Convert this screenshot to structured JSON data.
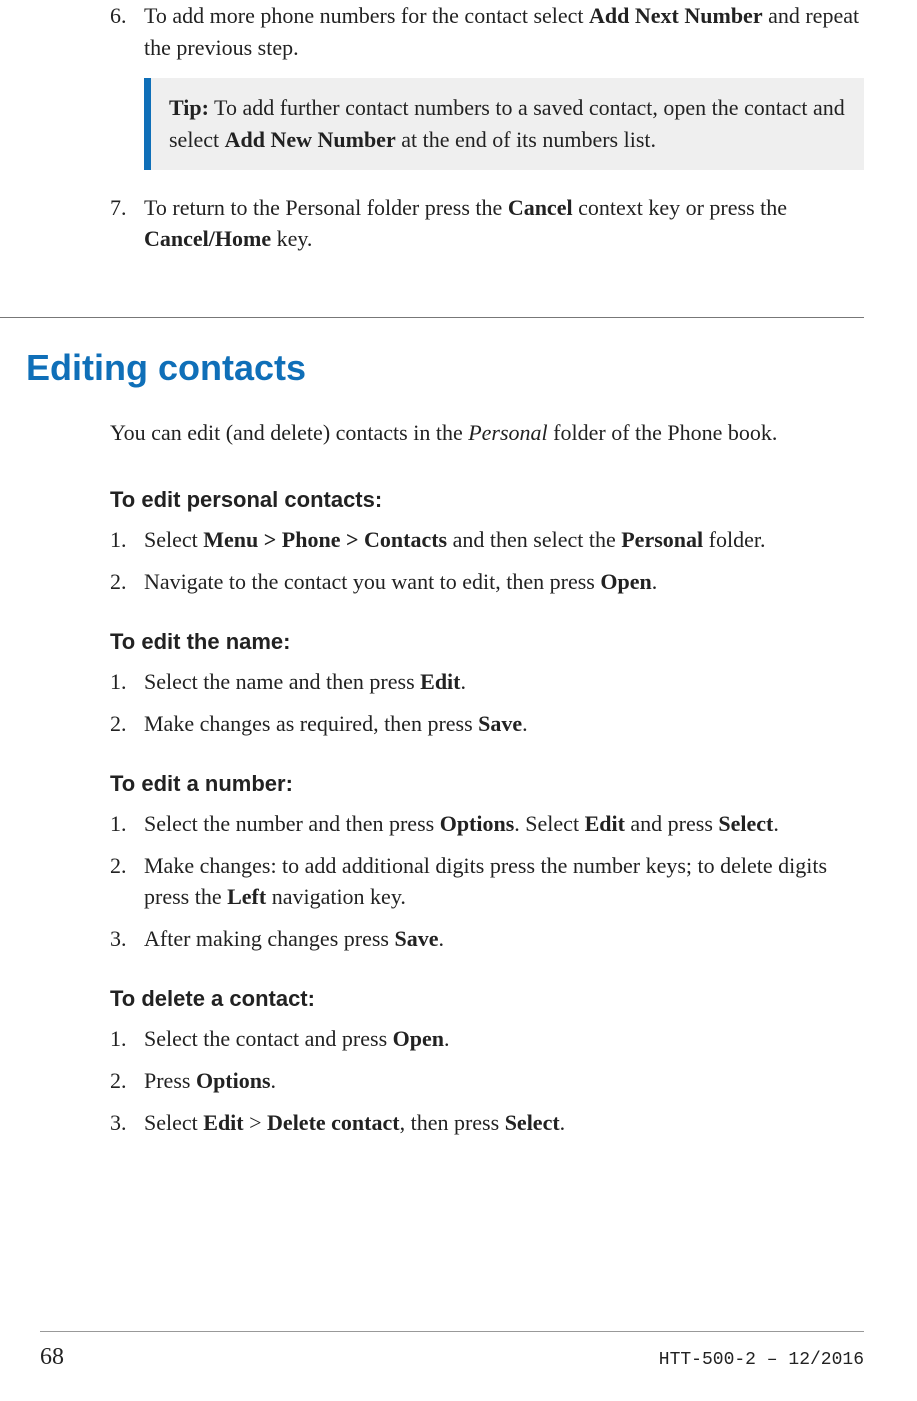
{
  "steps_cont": {
    "item6": {
      "num": "6.",
      "pre": "To add more phone numbers for the contact select ",
      "bold": "Add Next Number",
      "post": " and repeat the previous step."
    },
    "tip": {
      "label": "Tip:",
      "pre": "  To add further contact numbers to a saved contact, open the contact and select ",
      "bold": "Add New Number",
      "post": " at the end of its numbers list."
    },
    "item7": {
      "num": "7.",
      "pre": "To return to the Personal folder press the ",
      "bold1": "Cancel",
      "mid": " context key or press the ",
      "bold2": "Cancel/Home",
      "post": " key."
    }
  },
  "section": {
    "title": "Editing contacts",
    "intro_pre": "You can edit (and delete) contacts in the ",
    "intro_italic": "Personal",
    "intro_post": " folder of the Phone book."
  },
  "edit_personal": {
    "head": "To edit personal contacts:",
    "s1": {
      "num": "1.",
      "pre": "Select ",
      "bold1": "Menu > Phone > Contacts",
      "mid": " and then select the ",
      "bold2": "Personal",
      "post": " folder."
    },
    "s2": {
      "num": "2.",
      "pre": "Navigate to the contact you want to edit, then press ",
      "bold": "Open",
      "post": "."
    }
  },
  "edit_name": {
    "head": "To edit the name:",
    "s1": {
      "num": "1.",
      "pre": "Select the name and then press ",
      "bold": "Edit",
      "post": "."
    },
    "s2": {
      "num": "2.",
      "pre": "Make changes as required, then press ",
      "bold": "Save",
      "post": "."
    }
  },
  "edit_number": {
    "head": "To edit a number:",
    "s1": {
      "num": "1.",
      "pre": "Select the number and then press ",
      "bold1": "Options",
      "mid": ". Select ",
      "bold2": "Edit",
      "mid2": " and press ",
      "bold3": "Select",
      "post": "."
    },
    "s2": {
      "num": "2.",
      "pre": "Make changes: to add additional digits press the number keys; to delete digits press the ",
      "bold": "Left",
      "post": " navigation key."
    },
    "s3": {
      "num": "3.",
      "pre": "After making changes press ",
      "bold": "Save",
      "post": "."
    }
  },
  "delete_contact": {
    "head": "To delete a contact:",
    "s1": {
      "num": "1.",
      "pre": "Select the contact and press ",
      "bold": "Open",
      "post": "."
    },
    "s2": {
      "num": "2.",
      "pre": "Press ",
      "bold": "Options",
      "post": "."
    },
    "s3": {
      "num": "3.",
      "pre": "Select ",
      "bold1": "Edit",
      "mid": " > ",
      "bold2": "Delete contact",
      "mid2": ", then press ",
      "bold3": "Select",
      "post": "."
    }
  },
  "footer": {
    "page": "68",
    "docid": "HTT-500-2 – 12/2016"
  }
}
